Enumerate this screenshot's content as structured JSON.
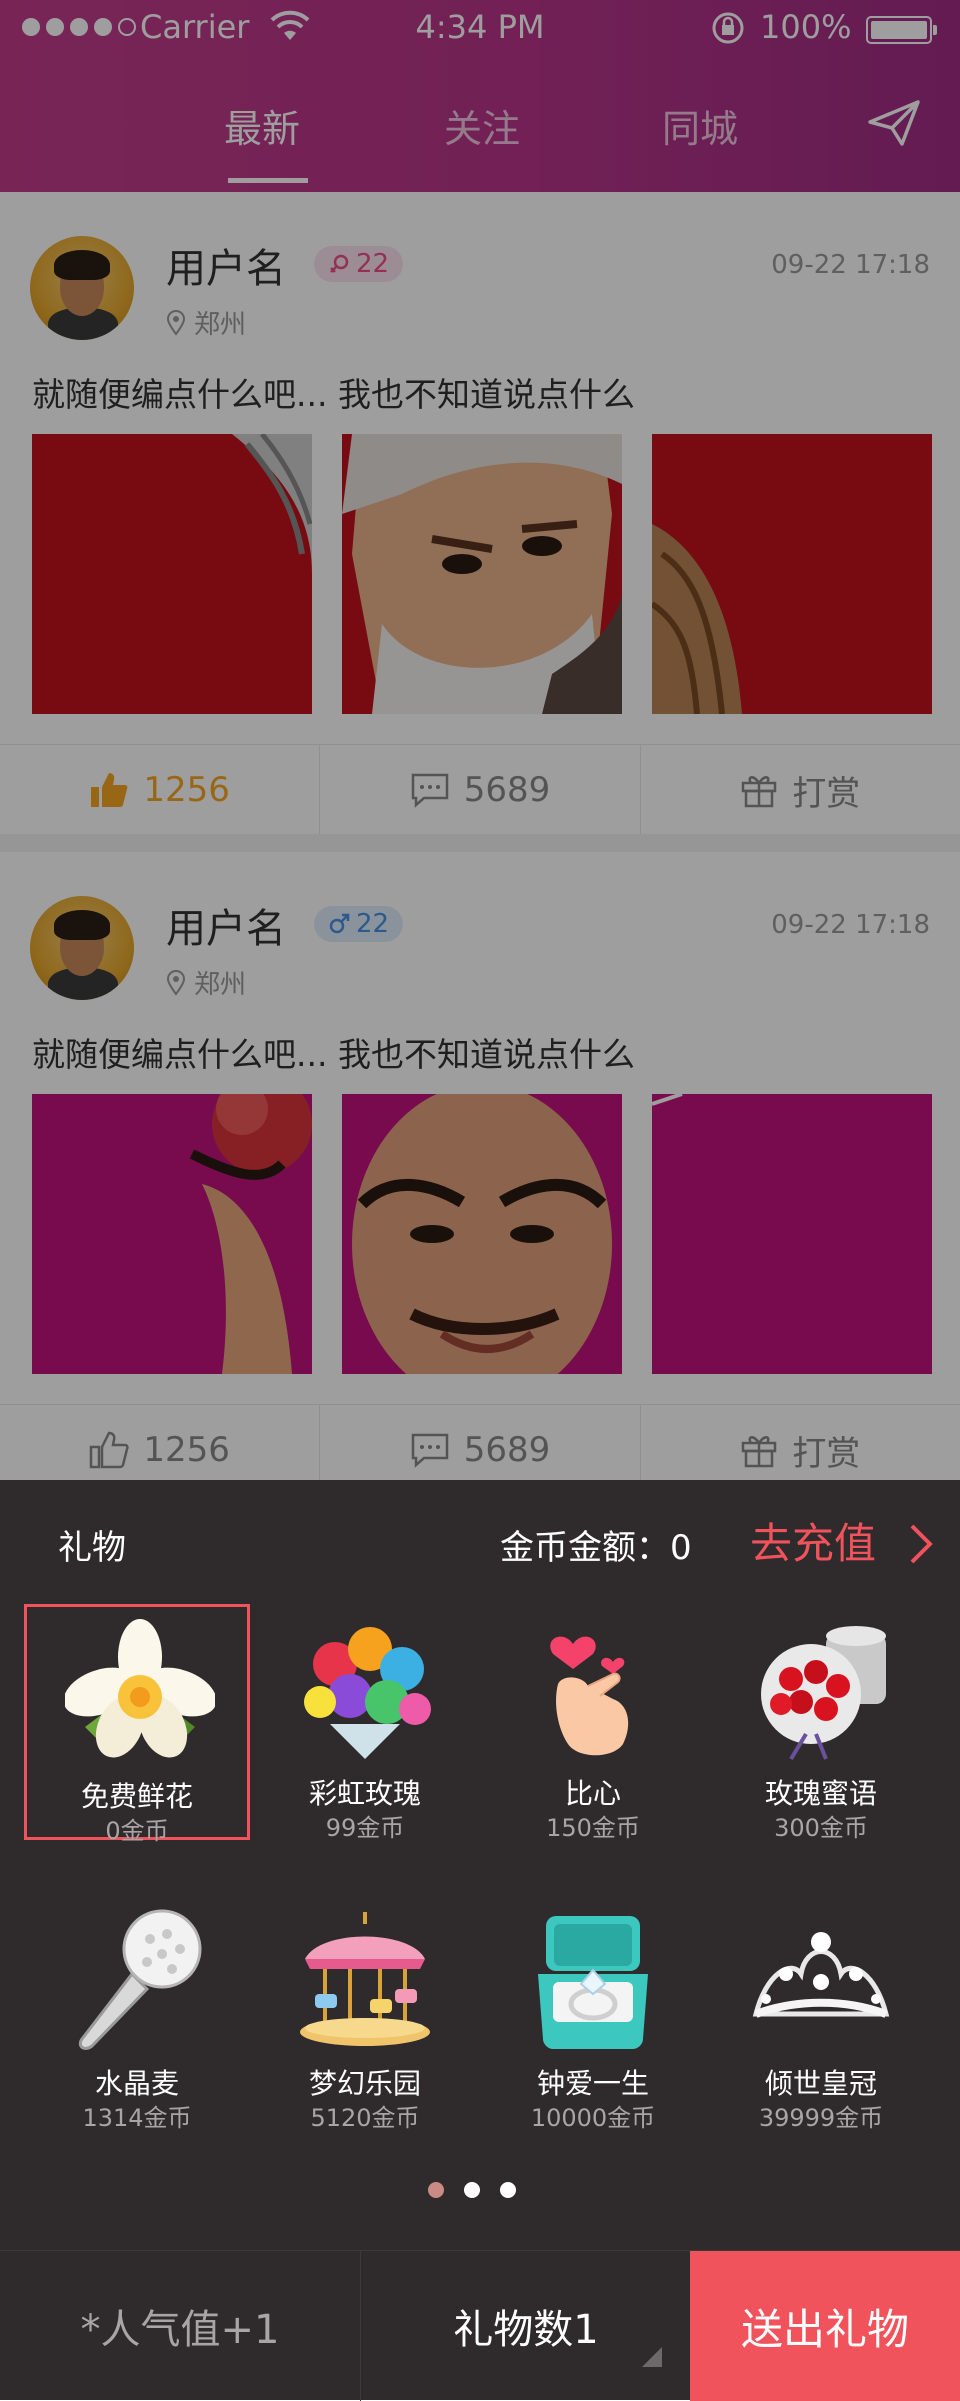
{
  "status_bar": {
    "carrier": "Carrier",
    "time": "4:34 PM",
    "battery": "100%"
  },
  "nav": {
    "tabs": [
      {
        "label": "最新",
        "active": true
      },
      {
        "label": "关注",
        "active": false
      },
      {
        "label": "同城",
        "active": false
      }
    ],
    "send_icon": "paper-plane-icon",
    "accent": "#b8358a"
  },
  "posts": [
    {
      "username": "用户名",
      "gender": "female",
      "level": "22",
      "location": "郑州",
      "time": "09-22 17:18",
      "content": "就随便编点什么吧...  我也不知道说点什么",
      "likes": "1256",
      "liked": true,
      "comments": "5689",
      "reward_label": "打赏",
      "photo_bg": "#c2121c"
    },
    {
      "username": "用户名",
      "gender": "male",
      "level": "22",
      "location": "郑州",
      "time": "09-22 17:18",
      "content": "就随便编点什么吧...  我也不知道说点什么",
      "likes": "1256",
      "liked": false,
      "comments": "5689",
      "reward_label": "打赏",
      "photo_bg": "#c2127e"
    }
  ],
  "gift_panel": {
    "title": "礼物",
    "coin_balance_label": "金币金额：0",
    "recharge_label": "去充值",
    "gifts": [
      {
        "name": "免费鲜花",
        "price": "0金币",
        "icon": "flower-icon",
        "selected": true
      },
      {
        "name": "彩虹玫瑰",
        "price": "99金币",
        "icon": "rainbow-rose-icon",
        "selected": false
      },
      {
        "name": "比心",
        "price": "150金币",
        "icon": "finger-heart-icon",
        "selected": false
      },
      {
        "name": "玫瑰蜜语",
        "price": "300金币",
        "icon": "rose-box-icon",
        "selected": false
      },
      {
        "name": "水晶麦",
        "price": "1314金币",
        "icon": "crystal-mic-icon",
        "selected": false
      },
      {
        "name": "梦幻乐园",
        "price": "5120金币",
        "icon": "carousel-icon",
        "selected": false
      },
      {
        "name": "钟爱一生",
        "price": "10000金币",
        "icon": "ring-box-icon",
        "selected": false
      },
      {
        "name": "倾世皇冠",
        "price": "39999金币",
        "icon": "crown-icon",
        "selected": false
      }
    ],
    "page_count": 3,
    "current_page": 1,
    "popularity_label": "*人气值+1",
    "gift_count_label": "礼物数1",
    "send_button_label": "送出礼物",
    "accent": "#f0535b"
  }
}
